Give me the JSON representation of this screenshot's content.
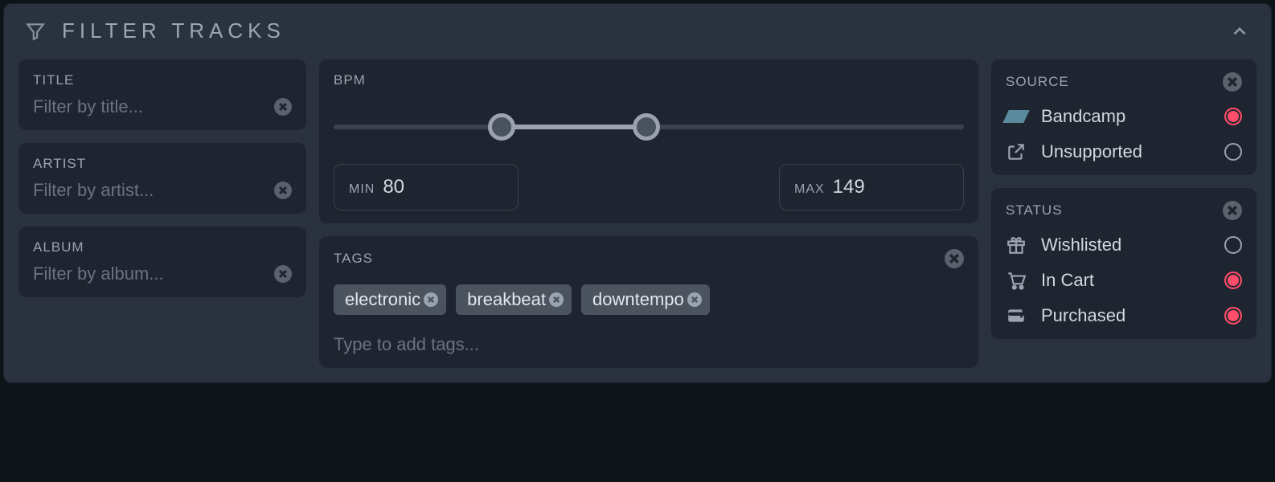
{
  "panel": {
    "title": "FILTER TRACKS"
  },
  "title_filter": {
    "label": "TITLE",
    "placeholder": "Filter by title...",
    "value": ""
  },
  "artist_filter": {
    "label": "ARTIST",
    "placeholder": "Filter by artist...",
    "value": ""
  },
  "album_filter": {
    "label": "ALBUM",
    "placeholder": "Filter by album...",
    "value": ""
  },
  "bpm": {
    "label": "BPM",
    "min_label": "MIN",
    "max_label": "MAX",
    "min": "80",
    "max": "149",
    "range_min": 0,
    "range_max": 300
  },
  "tags": {
    "label": "TAGS",
    "placeholder": "Type to add tags...",
    "items": [
      "electronic",
      "breakbeat",
      "downtempo"
    ]
  },
  "source": {
    "label": "SOURCE",
    "options": [
      {
        "name": "Bandcamp",
        "icon": "bandcamp",
        "selected": true
      },
      {
        "name": "Unsupported",
        "icon": "external",
        "selected": false
      }
    ]
  },
  "status": {
    "label": "STATUS",
    "options": [
      {
        "name": "Wishlisted",
        "icon": "gift",
        "selected": false
      },
      {
        "name": "In Cart",
        "icon": "cart",
        "selected": true
      },
      {
        "name": "Purchased",
        "icon": "wallet",
        "selected": true
      }
    ]
  }
}
